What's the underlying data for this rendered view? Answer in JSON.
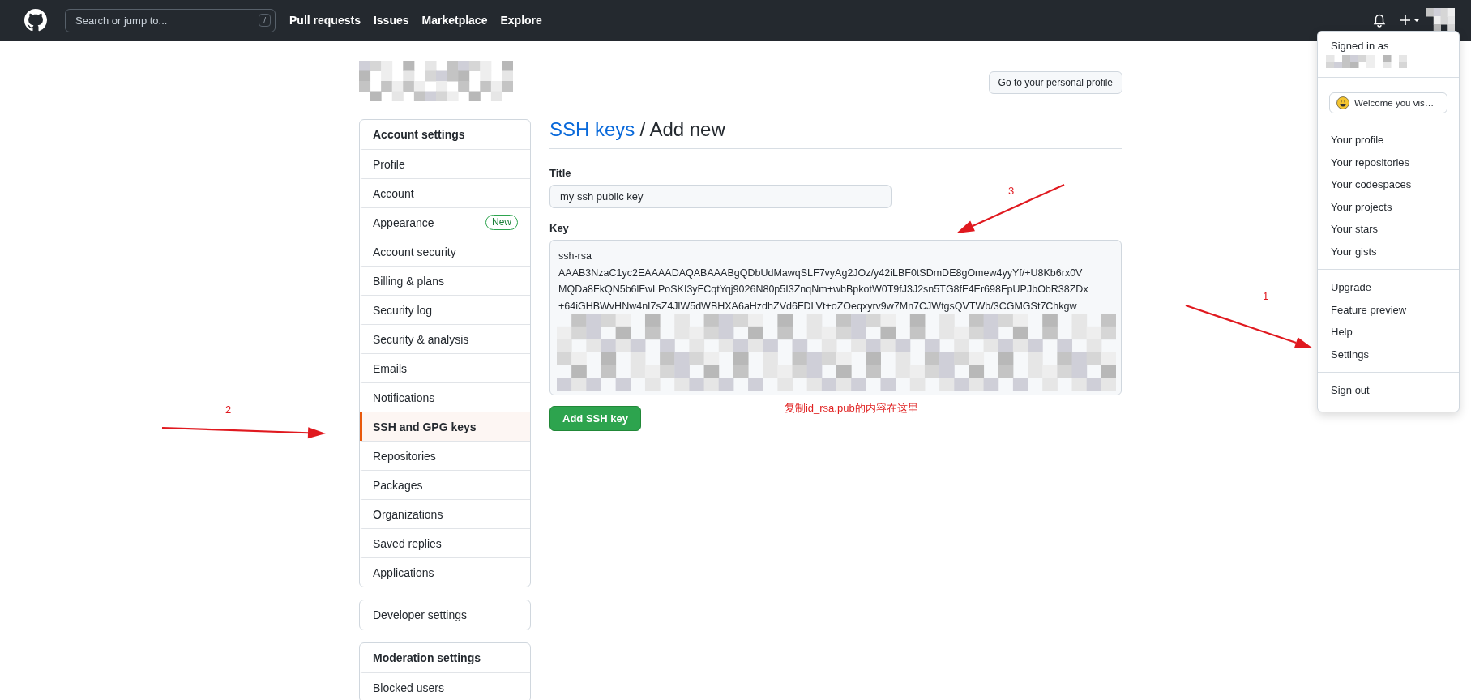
{
  "header": {
    "search": {
      "placeholder": "Search or jump to...",
      "shortcut": "/"
    },
    "nav": [
      "Pull requests",
      "Issues",
      "Marketplace",
      "Explore"
    ]
  },
  "profile_button": "Go to your personal profile",
  "sidebar": [
    {
      "heading": "Account settings",
      "items": [
        {
          "label": "Profile",
          "selected": false
        },
        {
          "label": "Account",
          "selected": false
        },
        {
          "label": "Appearance",
          "selected": false,
          "badge": "New"
        },
        {
          "label": "Account security",
          "selected": false
        },
        {
          "label": "Billing & plans",
          "selected": false
        },
        {
          "label": "Security log",
          "selected": false
        },
        {
          "label": "Security & analysis",
          "selected": false
        },
        {
          "label": "Emails",
          "selected": false
        },
        {
          "label": "Notifications",
          "selected": false
        },
        {
          "label": "SSH and GPG keys",
          "selected": true
        },
        {
          "label": "Repositories",
          "selected": false
        },
        {
          "label": "Packages",
          "selected": false
        },
        {
          "label": "Organizations",
          "selected": false
        },
        {
          "label": "Saved replies",
          "selected": false
        },
        {
          "label": "Applications",
          "selected": false
        }
      ]
    },
    {
      "items": [
        {
          "label": "Developer settings",
          "selected": false
        }
      ]
    },
    {
      "heading": "Moderation settings",
      "items": [
        {
          "label": "Blocked users",
          "selected": false
        }
      ]
    }
  ],
  "main": {
    "breadcrumb_link": "SSH keys",
    "title": "/ Add new",
    "fields": [
      {
        "label": "Title",
        "value": "my ssh public key"
      },
      {
        "label": "Key",
        "value": "ssh-rsa\nAAAB3NzaC1yc2EAAAADAQABAAABgQDbUdMawqSLF7vyAg2JOz/y42iLBF0tSDmDE8gOmew4yyYf/+U8Kb6rx0V\nMQDa8FkQN5b6lFwLPoSKI3yFCqtYqj9026N80p5I3ZnqNm+wbBpkotW0T9fJ3J2sn5TG8fF4Er698FpUPJbObR38ZDx\n+64iGHBWvHNw4nI7sZ4JlW5dWBHXA6aHzdhZVd6FDLVt+oZOeqxyrv9w7Mn7CJWtgsQVTWb/3CGMGSt7Chkgw"
      }
    ],
    "submit": "Add SSH key",
    "note": "复制id_rsa.pub的内容在这里"
  },
  "dropdown": {
    "signed_in": "Signed in as",
    "status": "Welcome you vis…",
    "groups": [
      [
        "Your profile",
        "Your repositories",
        "Your codespaces",
        "Your projects",
        "Your stars",
        "Your gists"
      ],
      [
        "Upgrade",
        "Feature preview",
        "Help",
        "Settings"
      ],
      [
        "Sign out"
      ]
    ]
  },
  "annotations": [
    {
      "label": "1"
    },
    {
      "label": "2"
    },
    {
      "label": "3"
    }
  ]
}
